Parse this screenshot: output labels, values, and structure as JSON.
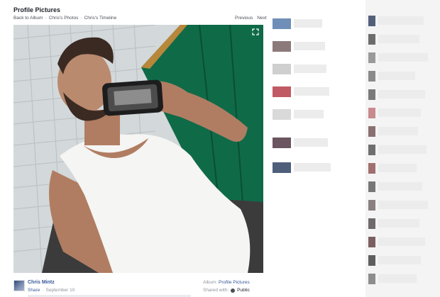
{
  "album": {
    "title": "Profile Pictures",
    "back_label": "Back to Album",
    "photos_label": "Chris's Photos",
    "timeline_label": "Chris's Timeline",
    "separator": "·"
  },
  "pager": {
    "previous": "Previous",
    "next": "Next"
  },
  "photo": {
    "expand_icon": "expand-icon"
  },
  "owner": {
    "name": "Chris Mintz",
    "share_label": "Share",
    "date": "September 10",
    "separator": "·"
  },
  "album_info": {
    "label": "Album:",
    "value": "Profile Pictures"
  },
  "shared_info": {
    "label": "Shared with:",
    "value": "Public",
    "icon": "globe-icon"
  },
  "colors": {
    "link_blue": "#365899",
    "text_dark": "#1d2129",
    "text_gray": "#90949c",
    "locker_green": "#0f6a48"
  }
}
